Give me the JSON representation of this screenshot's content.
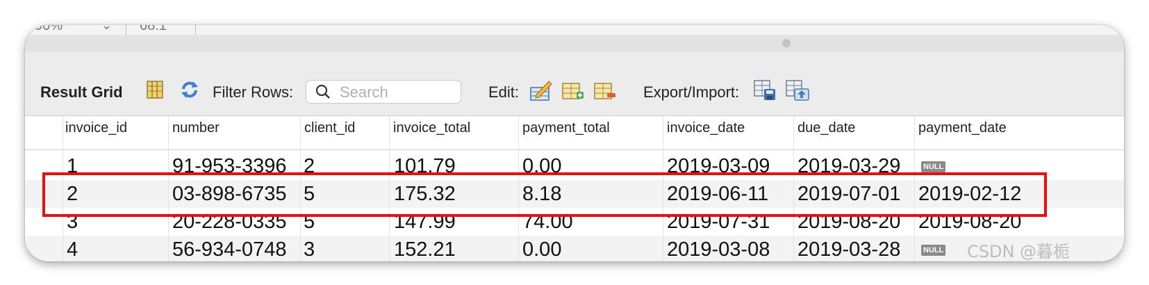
{
  "top_strip": {
    "zoom": "90%",
    "position": "68:1"
  },
  "toolbar": {
    "result_grid_label": "Result Grid",
    "filter_rows_label": "Filter Rows:",
    "search_placeholder": "Search",
    "edit_label": "Edit:",
    "export_import_label": "Export/Import:"
  },
  "table": {
    "columns": [
      "invoice_id",
      "number",
      "client_id",
      "invoice_total",
      "payment_total",
      "invoice_date",
      "due_date",
      "payment_date"
    ],
    "null_label": "NULL",
    "rows": [
      [
        "1",
        "91-953-3396",
        "2",
        "101.79",
        "0.00",
        "2019-03-09",
        "2019-03-29",
        "NULL"
      ],
      [
        "2",
        "03-898-6735",
        "5",
        "175.32",
        "8.18",
        "2019-06-11",
        "2019-07-01",
        "2019-02-12"
      ],
      [
        "3",
        "20-228-0335",
        "5",
        "147.99",
        "74.00",
        "2019-07-31",
        "2019-08-20",
        "2019-08-20"
      ],
      [
        "4",
        "56-934-0748",
        "3",
        "152.21",
        "0.00",
        "2019-03-08",
        "2019-03-28",
        "NULL"
      ]
    ]
  },
  "highlight_color": "#ee0d0d",
  "watermark": "CSDN @暮栀"
}
